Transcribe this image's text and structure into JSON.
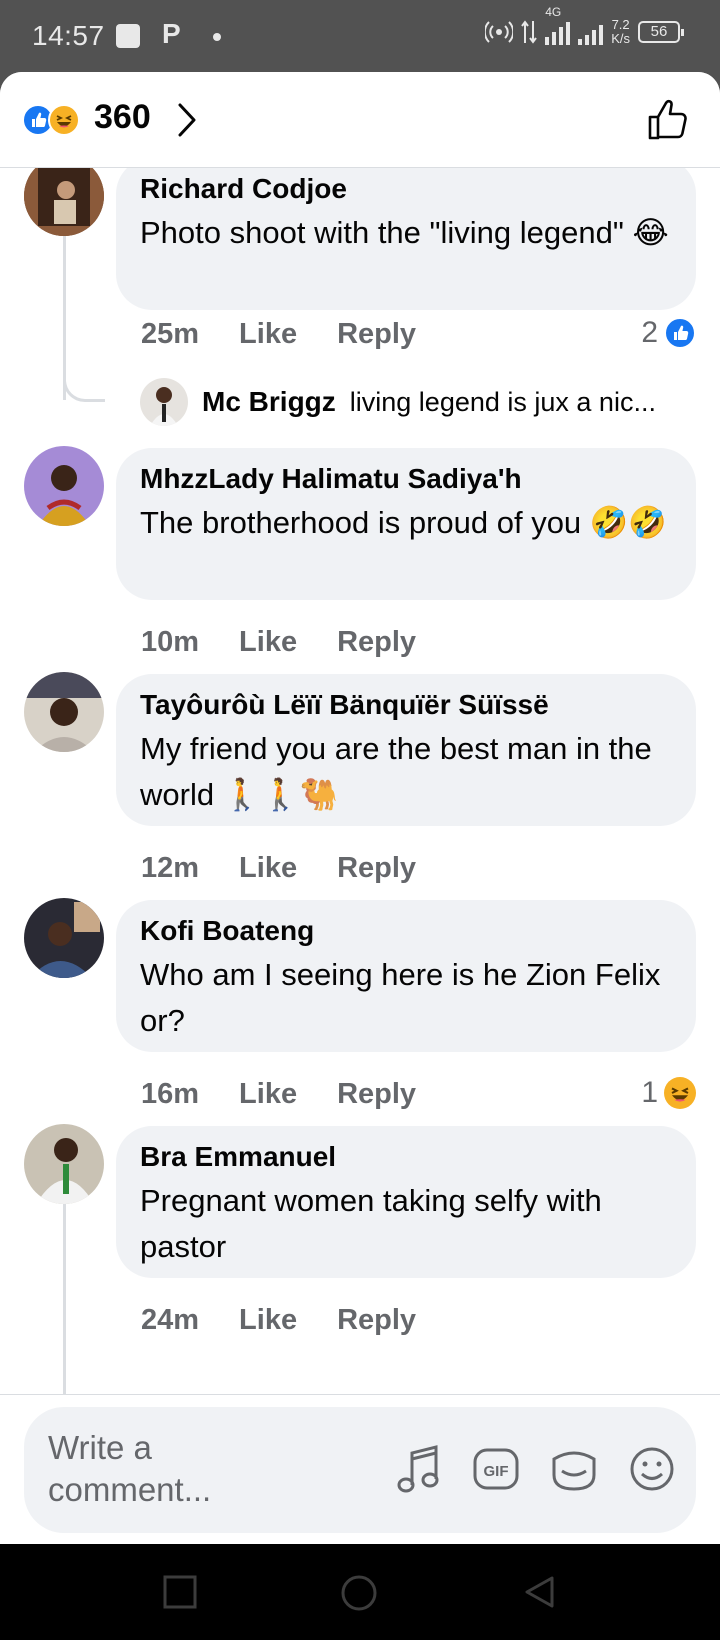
{
  "status_bar": {
    "time": "14:57",
    "network": "4G",
    "speed_value": "7.2",
    "speed_unit": "K/s",
    "battery": "56"
  },
  "header": {
    "reaction_count": "360"
  },
  "comments": [
    {
      "author": "Richard Codjoe",
      "text": "Photo shoot with the \"living legend\" 😂",
      "time": "25m",
      "like_label": "Like",
      "reply_label": "Reply",
      "reaction_count": "2",
      "reaction_icon": "like-icon",
      "reply_preview": {
        "author": "Mc Briggz",
        "text": "living legend is jux a nic..."
      }
    },
    {
      "author": "MhzzLady Halimatu Sadiya'h",
      "text": "The brotherhood is proud of you 🤣🤣",
      "time": "10m",
      "like_label": "Like",
      "reply_label": "Reply"
    },
    {
      "author": "Tayôurôù Lëïï Bänquïër Süïssë",
      "text": "My friend you are the best man in the world 🚶🚶🐫",
      "time": "12m",
      "like_label": "Like",
      "reply_label": "Reply"
    },
    {
      "author": "Kofi Boateng",
      "text": "Who am I seeing here is he Zion Felix or?",
      "time": "16m",
      "like_label": "Like",
      "reply_label": "Reply",
      "reaction_count": "1",
      "reaction_icon": "haha-icon"
    },
    {
      "author": "Bra Emmanuel",
      "text": "Pregnant women taking selfy with pastor",
      "time": "24m",
      "like_label": "Like",
      "reply_label": "Reply"
    }
  ],
  "composer": {
    "placeholder": "Write a comment...",
    "icons": [
      "music-icon",
      "gif-icon",
      "sticker-icon",
      "emoji-icon"
    ]
  },
  "colors": {
    "accent": "#1877f2",
    "haha": "#f7b125",
    "bubble": "#f0f2f5",
    "meta": "#65676b"
  }
}
